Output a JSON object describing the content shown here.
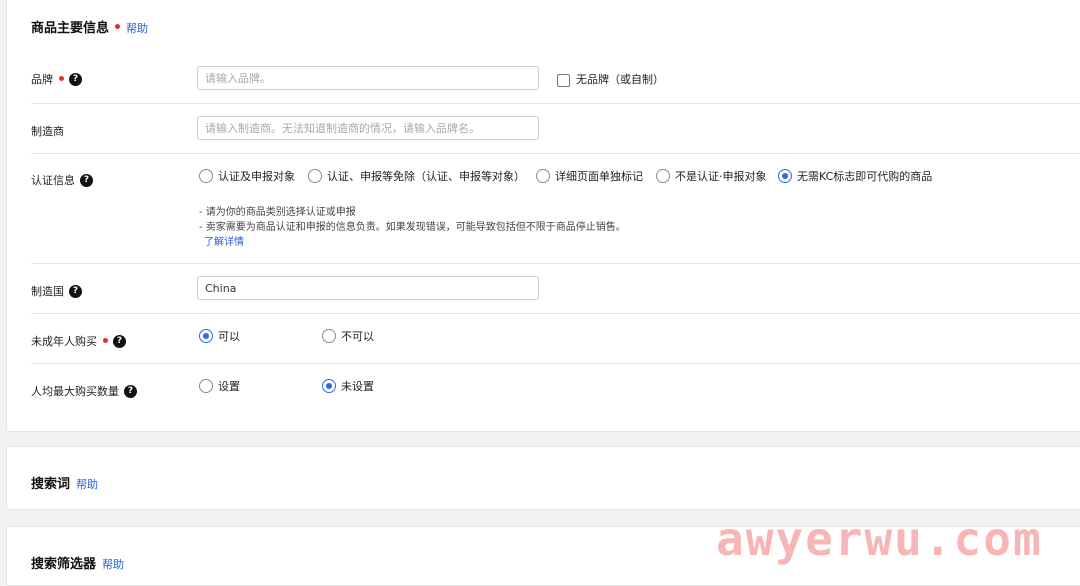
{
  "main_section": {
    "title": "商品主要信息",
    "help": "帮助"
  },
  "brand": {
    "label": "品牌",
    "placeholder": "请输入品牌。",
    "no_brand_label": "无品牌（或自制）"
  },
  "manufacturer": {
    "label": "制造商",
    "placeholder": "请输入制造商。无法知道制造商的情况，请输入品牌名。"
  },
  "certification": {
    "label": "认证信息",
    "options": [
      "认证及申报对象",
      "认证、申报等免除（认证、申报等对象）",
      "详细页面单独标记",
      "不是认证·申报对象",
      "无需KC标志即可代购的商品"
    ],
    "selected_index": 4,
    "notes": [
      "- 请为你的商品类别选择认证或申报",
      "- 卖家需要为商品认证和申报的信息负责。如果发现错误，可能导致包括但不限于商品停止销售。"
    ],
    "learn_more": "了解详情"
  },
  "origin": {
    "label": "制造国",
    "value": "China"
  },
  "minor_purchase": {
    "label": "未成年人购买",
    "options": [
      "可以",
      "不可以"
    ],
    "selected_index": 0
  },
  "max_purchase": {
    "label": "人均最大购买数量",
    "options": [
      "设置",
      "未设置"
    ],
    "selected_index": 1
  },
  "search_section": {
    "title": "搜索词",
    "help": "帮助"
  },
  "filter_section": {
    "title": "搜索筛选器",
    "help": "帮助"
  },
  "watermark": "awyerwu.com",
  "colors": {
    "accent": "#2e6be6",
    "required": "#e0332f",
    "link": "#2760d8"
  }
}
